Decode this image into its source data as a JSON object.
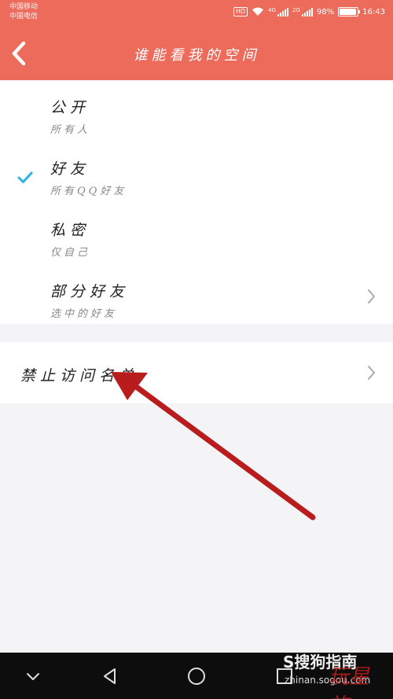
{
  "status_bar": {
    "carrier_1": "中国移动",
    "carrier_2": "中国电信",
    "hd_badge": "HD",
    "network_1": "4G",
    "network_2": "2G",
    "battery": "98%",
    "time": "16:43"
  },
  "header": {
    "title": "谁能看我的空间",
    "back_icon": "chevron-left-icon"
  },
  "options": [
    {
      "label": "公开",
      "sub": "所有人",
      "selected": false,
      "has_chevron": false
    },
    {
      "label": "好友",
      "sub": "所有QQ好友",
      "selected": true,
      "has_chevron": false
    },
    {
      "label": "私密",
      "sub": "仅自己",
      "selected": false,
      "has_chevron": false
    },
    {
      "label": "部分好友",
      "sub": "选中的好友",
      "selected": false,
      "has_chevron": true
    }
  ],
  "ban_list": {
    "label": "禁止访问名单"
  },
  "nav": {
    "icons": [
      "chevron-down-icon",
      "back-triangle-icon",
      "home-circle-icon",
      "recents-square-icon"
    ]
  },
  "watermark": {
    "logo": "S搜狗指南",
    "url": "zhinan.sogou.com",
    "seal": "玩星族"
  },
  "colors": {
    "header": "#ec6b5b",
    "check": "#2ab4e4",
    "arrow": "#b81c1c",
    "background": "#f4f4f7"
  }
}
